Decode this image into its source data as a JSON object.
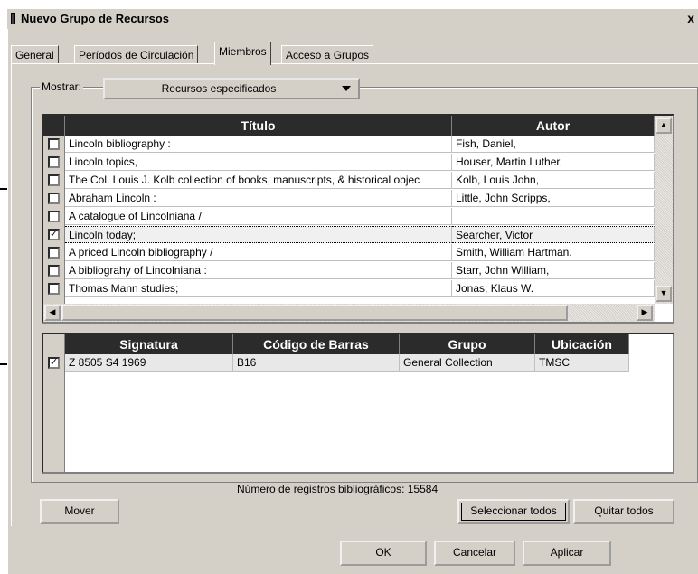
{
  "window": {
    "title": "Nuevo Grupo de Recursos",
    "close_label": "x"
  },
  "tabs": [
    {
      "label": "General"
    },
    {
      "label": "Períodos de Circulación"
    },
    {
      "label": "Miembros",
      "active": true
    },
    {
      "label": "Acceso a Grupos"
    }
  ],
  "filter": {
    "label": "Mostrar:",
    "value": "Recursos especificados"
  },
  "titles_table": {
    "columns": [
      "Título",
      "Autor"
    ],
    "rows": [
      {
        "checked": false,
        "title": "Lincoln bibliography :",
        "author": "Fish, Daniel,"
      },
      {
        "checked": false,
        "title": "Lincoln topics,",
        "author": "Houser, Martin Luther,"
      },
      {
        "checked": false,
        "title": "The Col. Louis J. Kolb collection of books, manuscripts, & historical objec",
        "author": "Kolb, Louis John,"
      },
      {
        "checked": false,
        "title": "Abraham Lincoln :",
        "author": "Little, John Scripps,"
      },
      {
        "checked": false,
        "title": "A catalogue of Lincolniana /",
        "author": ""
      },
      {
        "checked": true,
        "title": "Lincoln today;",
        "author": "Searcher, Victor",
        "selected": true
      },
      {
        "checked": false,
        "title": "A priced Lincoln bibliography /",
        "author": "Smith, William Hartman."
      },
      {
        "checked": false,
        "title": "A bibliograhy of Lincolniana :",
        "author": "Starr, John William,"
      },
      {
        "checked": false,
        "title": "Thomas Mann studies;",
        "author": "Jonas, Klaus W."
      }
    ]
  },
  "items_table": {
    "columns": [
      "Signatura",
      "Código de Barras",
      "Grupo",
      "Ubicación"
    ],
    "rows": [
      {
        "checked": true,
        "signatura": "Z 8505 S4 1969",
        "barcode": "B16",
        "group": "General Collection",
        "location": "TMSC"
      }
    ]
  },
  "record_count": "Número de registros bibliográficos: 15584",
  "buttons": {
    "move": "Mover",
    "select_all": "Seleccionar todos",
    "clear_all": "Quitar todos",
    "ok": "OK",
    "cancel": "Cancelar",
    "apply": "Aplicar"
  },
  "icons": [
    "window-icon",
    "dropdown-arrow-icon",
    "scroll-up-icon",
    "scroll-down-icon",
    "scroll-left-icon",
    "scroll-right-icon",
    "pointer-arrow-icon",
    "checkmark-icon"
  ]
}
